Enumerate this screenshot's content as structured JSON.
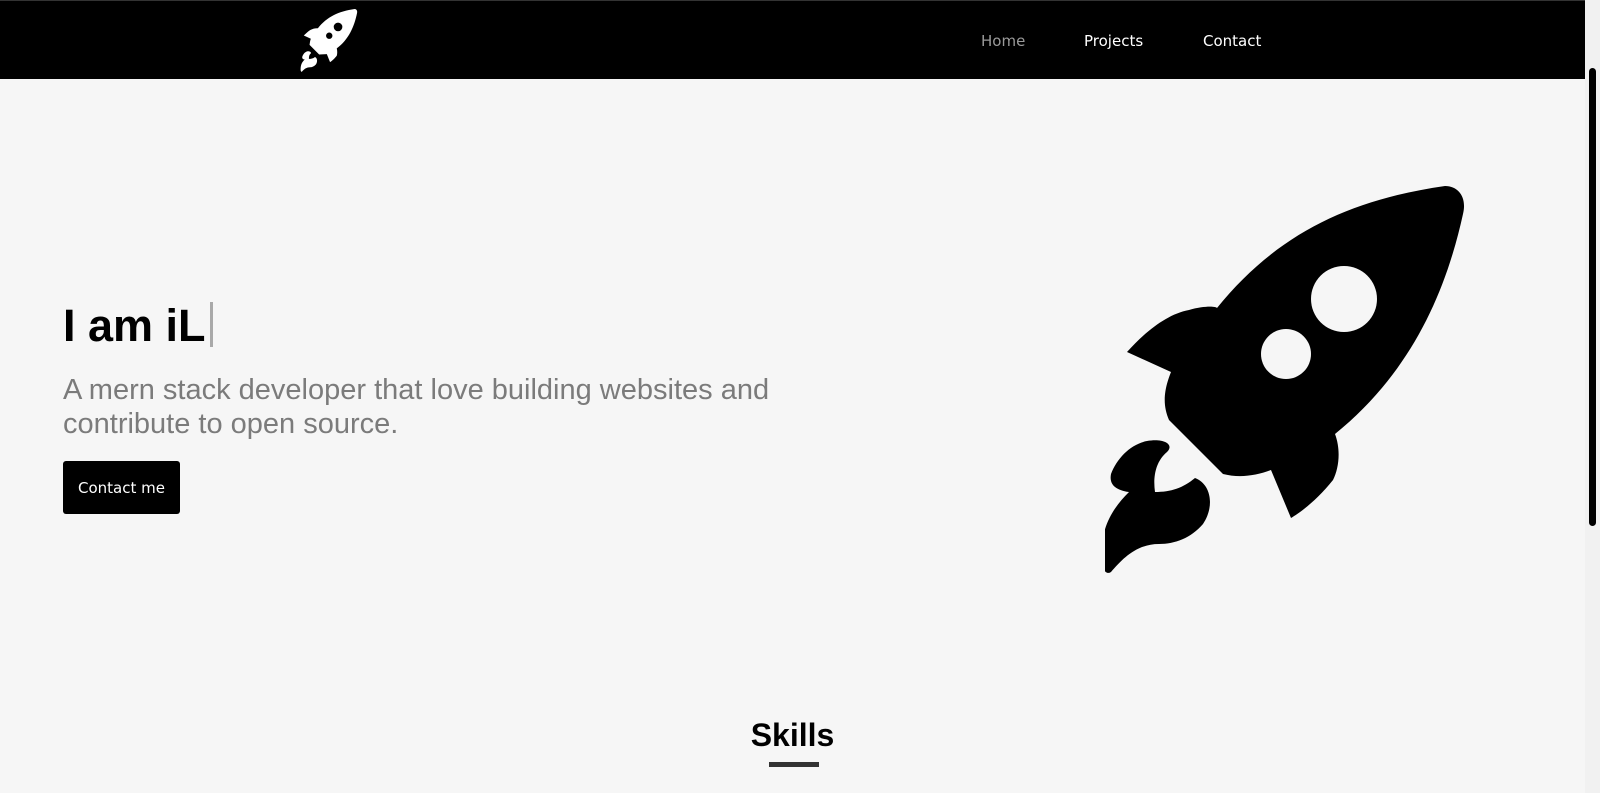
{
  "nav": {
    "logo_icon": "rocket-icon",
    "links": [
      {
        "label": "Home",
        "active": true
      },
      {
        "label": "Projects",
        "active": false
      },
      {
        "label": "Contact",
        "active": false
      }
    ]
  },
  "hero": {
    "title": "I am iL",
    "subtitle": "A mern stack developer that love building websites and contribute to open source.",
    "cta_label": "Contact me",
    "illustration_icon": "rocket-icon"
  },
  "skills": {
    "heading": "Skills"
  },
  "colors": {
    "nav_bg": "#000000",
    "page_bg": "#f6f6f6",
    "accent": "#000000",
    "subtitle": "#7b7b7b",
    "nav_active": "#9a9a9a"
  }
}
